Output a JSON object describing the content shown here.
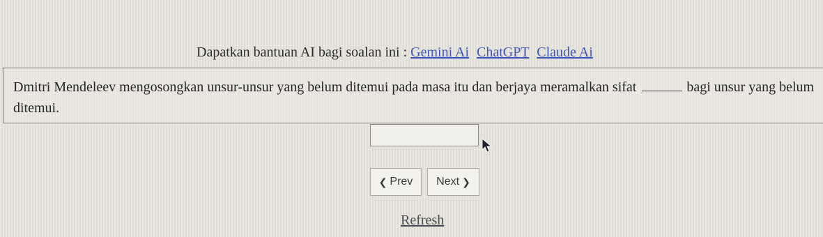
{
  "top_faint_text": "",
  "help": {
    "prefix": "Dapatkan bantuan AI bagi soalan ini :",
    "links": [
      "Gemini Ai",
      "ChatGPT",
      "Claude Ai"
    ]
  },
  "question": {
    "before_blank": "Dmitri Mendeleev mengosongkan unsur-unsur yang belum ditemui pada masa itu dan berjaya meramalkan sifat",
    "after_blank": "bagi unsur yang belum ditemui."
  },
  "answer": {
    "value": ""
  },
  "nav": {
    "prev_label": "Prev",
    "next_label": "Next",
    "prev_icon": "chevron-left-icon",
    "next_icon": "chevron-right-icon"
  },
  "refresh_label": "Refresh",
  "colors": {
    "link": "#3f58b8",
    "background": "#e6e4dd"
  }
}
